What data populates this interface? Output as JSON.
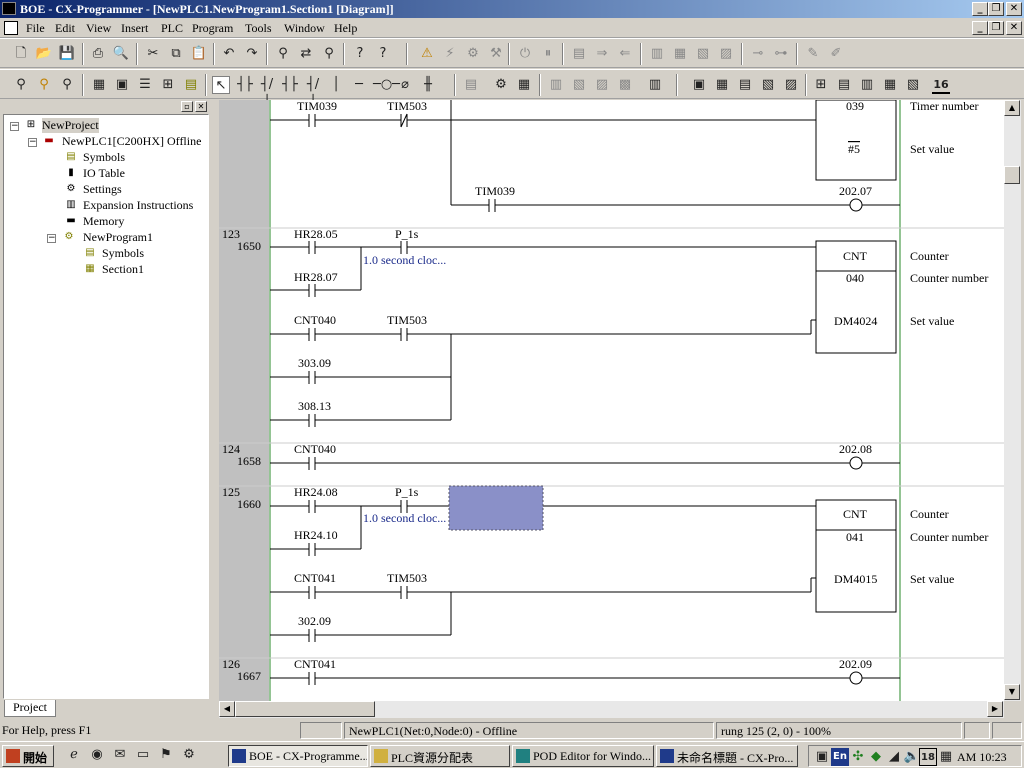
{
  "window": {
    "title": "BOE - CX-Programmer - [NewPLC1.NewProgram1.Section1 [Diagram]]"
  },
  "menu": [
    "File",
    "Edit",
    "View",
    "Insert",
    "PLC",
    "Program",
    "Tools",
    "Window",
    "Help"
  ],
  "toolbar1": [
    "new-icon",
    "open-icon",
    "save-icon",
    "print-icon",
    "print-preview-icon",
    "cut-icon",
    "copy-icon",
    "paste-icon",
    "undo-icon",
    "redo-icon",
    "find-icon",
    "replace-icon",
    "find-next-icon",
    "help-icon",
    "context-help-icon",
    "warning-icon",
    "work-online-icon",
    "auto-online-icon",
    "program-mode-icon",
    "run-icon",
    "pause-icon",
    "compile-icon",
    "transfer-to-plc-icon",
    "transfer-from-plc-icon",
    "compare-icon",
    "monitor-icon",
    "monitor-differential-icon",
    "force-icon",
    "force-on-icon",
    "set-value-icon",
    "online-edit-icon",
    "begin-edit-icon",
    "cancel-edit-icon"
  ],
  "toolbar2": [
    "zoom-out-icon",
    "zoom-fit-icon",
    "zoom-in-icon",
    "grid-icon",
    "show-comments-icon",
    "rung-comments-icon",
    "show-bookmarks-icon",
    "monochrome-icon",
    "select-mode-icon",
    "contact-no-icon",
    "contact-nc-icon",
    "or-no-icon",
    "or-nc-icon",
    "vertical-line-icon",
    "horizontal-line-icon",
    "coil-no-icon",
    "coil-nc-icon",
    "instruction-icon",
    "watch-icon",
    "cross-ref-icon",
    "address-ref-icon",
    "properties-icon",
    "rung-info-icon",
    "view-diagram-icon",
    "view-mnemonic-icon",
    "local-symbols-icon",
    "sfc-icon",
    "io-table-icon",
    "project-icon",
    "output-icon",
    "watch-window-icon",
    "address-icon",
    "cross-ref-report-icon",
    "hex-16-icon"
  ],
  "toolbar2_label_16": "16",
  "project_tree": {
    "tab": "Project",
    "items": [
      {
        "label": "NewProject",
        "icon": "network-icon"
      },
      {
        "label": "NewPLC1[C200HX] Offline",
        "icon": "plc-icon"
      },
      {
        "label": "Symbols",
        "icon": "symbols-icon"
      },
      {
        "label": "IO Table",
        "icon": "io-table-icon"
      },
      {
        "label": "Settings",
        "icon": "settings-icon"
      },
      {
        "label": "Expansion Instructions",
        "icon": "expansion-icon"
      },
      {
        "label": "Memory",
        "icon": "memory-icon"
      },
      {
        "label": "NewProgram1",
        "icon": "program-icon"
      },
      {
        "label": "Symbols",
        "icon": "symbols-icon"
      },
      {
        "label": "Section1",
        "icon": "section-icon"
      }
    ]
  },
  "ladder": {
    "rung122": {
      "c1": "TIM039",
      "c2": "TIM503",
      "num": "039",
      "sv": "#5",
      "c3": "TIM039",
      "out": "202.07",
      "cmt1": "Timer number",
      "cmt2": "Set value"
    },
    "rung123": {
      "step": "123",
      "addr": "1650",
      "c1": "HR28.05",
      "c2": "P_1s",
      "c2cmt": "1.0 second cloc...",
      "c3": "HR28.07",
      "c4": "CNT040",
      "c5": "TIM503",
      "c6": "303.09",
      "c7": "308.13",
      "instr": "CNT",
      "num": "040",
      "sv": "DM4024",
      "cmt1": "Counter",
      "cmt2": "Counter number",
      "cmt3": "Set value"
    },
    "rung124": {
      "step": "124",
      "addr": "1658",
      "c1": "CNT040",
      "out": "202.08"
    },
    "rung125": {
      "step": "125",
      "addr": "1660",
      "c1": "HR24.08",
      "c2": "P_1s",
      "c2cmt": "1.0 second cloc...",
      "c3": "HR24.10",
      "c4": "CNT041",
      "c5": "TIM503",
      "c6": "302.09",
      "instr": "CNT",
      "num": "041",
      "sv": "DM4015",
      "cmt1": "Counter",
      "cmt2": "Counter number",
      "cmt3": "Set value"
    },
    "rung126": {
      "step": "126",
      "addr": "1667",
      "c1": "CNT041",
      "out": "202.09"
    }
  },
  "status": {
    "help": "For Help, press F1",
    "plc": "NewPLC1(Net:0,Node:0) - Offline",
    "pos": "rung 125 (2, 0)  - 100%"
  },
  "taskbar": {
    "start": "開始",
    "tasks": [
      "BOE - CX-Programme...",
      "PLC資源分配表",
      "POD Editor for Windo...",
      "未命名標題 - CX-Pro..."
    ],
    "tray_lang": "En",
    "tray_date": "18",
    "clock": "AM 10:23"
  }
}
